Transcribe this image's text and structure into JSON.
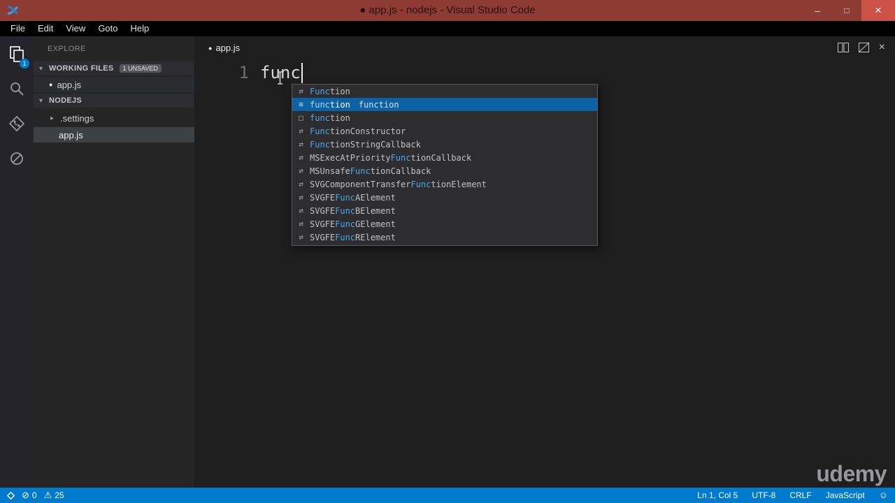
{
  "window": {
    "title": "● app.js - nodejs - Visual Studio Code"
  },
  "icons": {
    "minimize": "–",
    "maximize": "□",
    "close": "×",
    "dirty_dot": "●",
    "chevron_down": "▾",
    "chevron_right": "▸",
    "error": "⊘",
    "warning": "⚠",
    "smiley": "☺"
  },
  "menubar": {
    "items": [
      "File",
      "Edit",
      "View",
      "Goto",
      "Help"
    ]
  },
  "activitybar": {
    "badge": "1"
  },
  "sidebar": {
    "title": "EXPLORE",
    "sections": [
      {
        "label": "WORKING FILES",
        "badge": "1 UNSAVED",
        "items": [
          {
            "label": "app.js"
          }
        ]
      },
      {
        "label": "NODEJS",
        "items": [
          {
            "label": ".settings"
          },
          {
            "label": "app.js"
          }
        ]
      }
    ]
  },
  "editor": {
    "filename": "app.js",
    "line_number": "1",
    "code": "func"
  },
  "suggest": {
    "items": [
      {
        "icon": "⇄",
        "pre": "",
        "match": "Func",
        "post": "tion",
        "detail": ""
      },
      {
        "icon": "≡",
        "pre": "",
        "match": "func",
        "post": "tion",
        "detail": "function"
      },
      {
        "icon": "□",
        "pre": "",
        "match": "func",
        "post": "tion",
        "detail": ""
      },
      {
        "icon": "⇄",
        "pre": "",
        "match": "Func",
        "post": "tionConstructor",
        "detail": ""
      },
      {
        "icon": "⇄",
        "pre": "",
        "match": "Func",
        "post": "tionStringCallback",
        "detail": ""
      },
      {
        "icon": "⇄",
        "pre": "MSExecAtPriority",
        "match": "Func",
        "post": "tionCallback",
        "detail": ""
      },
      {
        "icon": "⇄",
        "pre": "MSUnsafe",
        "match": "Func",
        "post": "tionCallback",
        "detail": ""
      },
      {
        "icon": "⇄",
        "pre": "SVGComponentTransfer",
        "match": "Func",
        "post": "tionElement",
        "detail": ""
      },
      {
        "icon": "⇄",
        "pre": "SVGFE",
        "match": "Func",
        "post": "AElement",
        "detail": ""
      },
      {
        "icon": "⇄",
        "pre": "SVGFE",
        "match": "Func",
        "post": "BElement",
        "detail": ""
      },
      {
        "icon": "⇄",
        "pre": "SVGFE",
        "match": "Func",
        "post": "GElement",
        "detail": ""
      },
      {
        "icon": "⇄",
        "pre": "SVGFE",
        "match": "Func",
        "post": "RElement",
        "detail": ""
      }
    ]
  },
  "statusbar": {
    "errors": "0",
    "warnings": "25",
    "ln_col": "Ln 1, Col 5",
    "encoding": "UTF-8",
    "eol": "CRLF",
    "language": "JavaScript"
  },
  "watermark": "udemy"
}
